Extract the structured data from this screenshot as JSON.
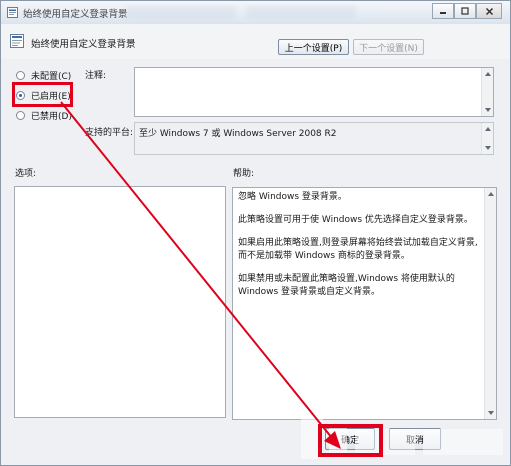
{
  "window": {
    "title": "始终使用自定义登录背景",
    "icon": "policy-icon",
    "caption_buttons": [
      "minimize-icon",
      "maximize-icon",
      "close-icon"
    ]
  },
  "header": {
    "title": "始终使用自定义登录背景",
    "icon": "policy-setting-icon"
  },
  "nav": {
    "prev_label": "上一个设置(P)",
    "next_label": "下一个设置(N)",
    "next_enabled": false
  },
  "radio_options": [
    {
      "label": "未配置(C)",
      "selected": false
    },
    {
      "label": "已启用(E)",
      "selected": true
    },
    {
      "label": "已禁用(D)",
      "selected": false
    }
  ],
  "comment": {
    "label": "注释:",
    "value": ""
  },
  "platform": {
    "label": "支持的平台:",
    "value": "至少 Windows 7 或 Windows Server 2008 R2"
  },
  "options_section": {
    "label": "选项:"
  },
  "help_section": {
    "label": "帮助:",
    "paragraphs": [
      "忽略 Windows 登录背景。",
      "此策略设置可用于使 Windows 优先选择自定义登录背景。",
      "如果启用此策略设置,则登录屏幕将始终尝试加载自定义背景,而不是加载带 Windows 商标的登录背景。",
      "如果禁用或未配置此策略设置,Windows 将使用默认的 Windows 登录背景或自定义背景。"
    ]
  },
  "buttons": {
    "ok_label": "确定",
    "cancel_label": "取消"
  },
  "annotation": {
    "highlight_color": "#e0001b"
  }
}
